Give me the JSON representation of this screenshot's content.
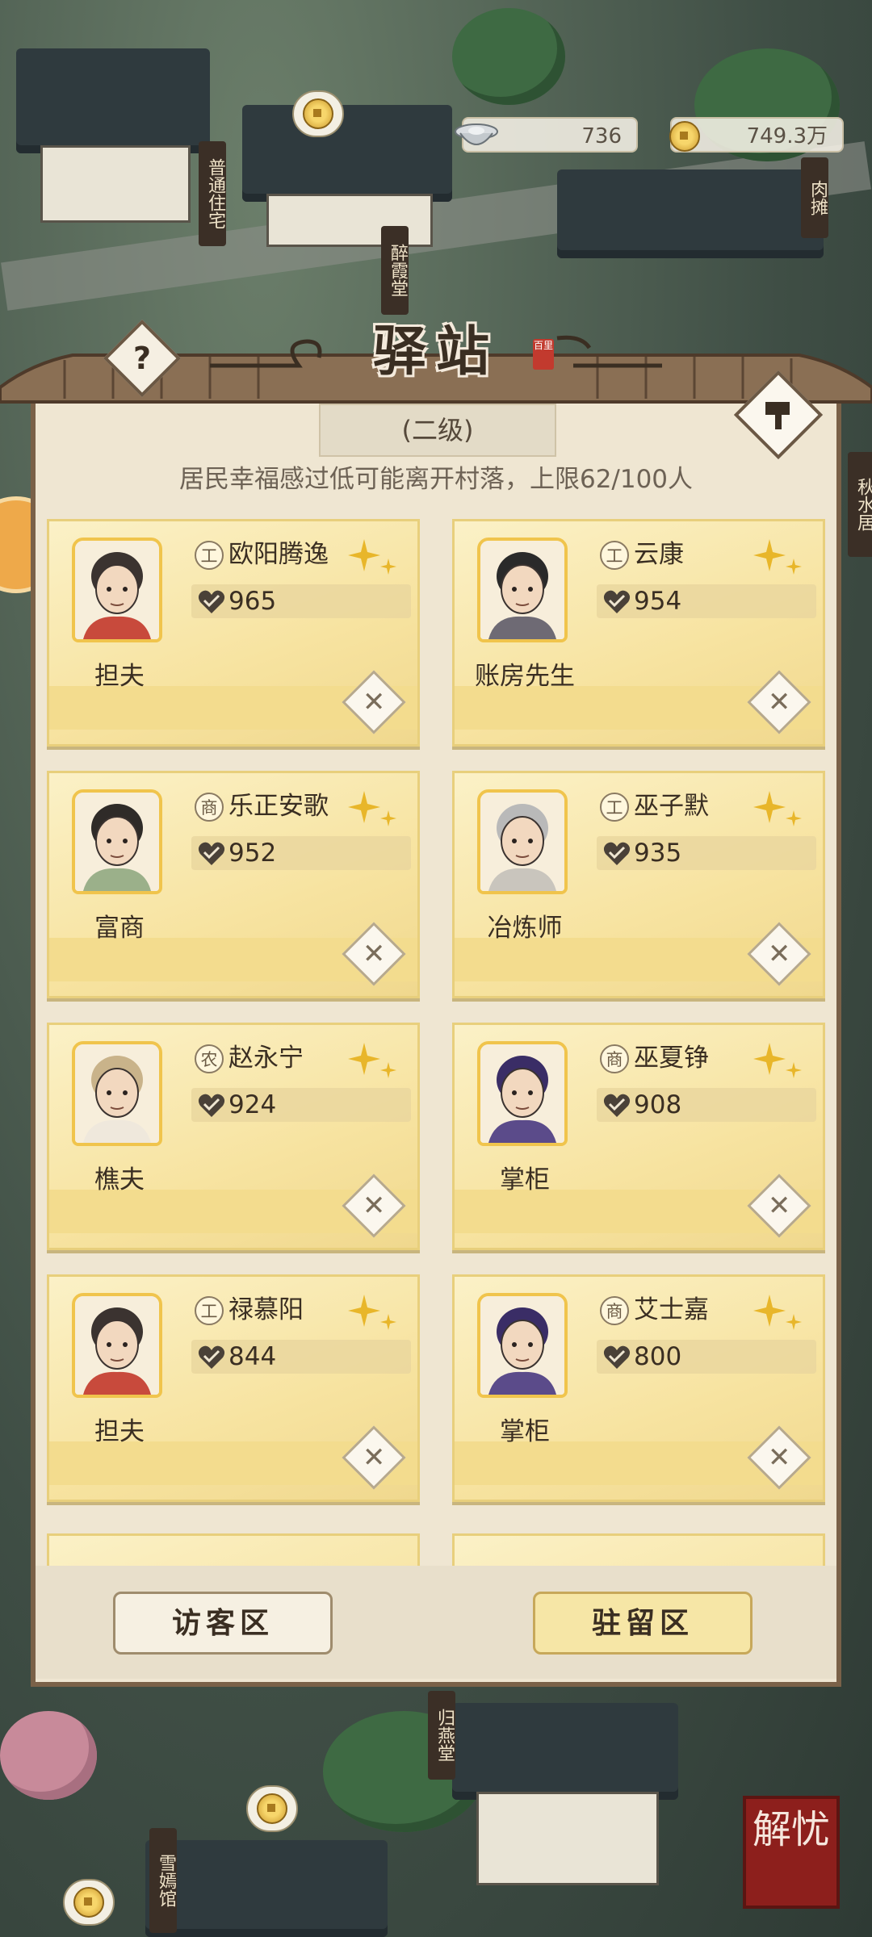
{
  "resources": {
    "silver": "736",
    "coins": "749.3万"
  },
  "panel": {
    "title": "驿站",
    "seal": "百里",
    "level": "(二级)",
    "notice": "居民幸福感过低可能离开村落，上限62/100人"
  },
  "residents": [
    {
      "job": "担夫",
      "category": "工",
      "name": "欧阳腾逸",
      "score": "965"
    },
    {
      "job": "账房先生",
      "category": "工",
      "name": "云康",
      "score": "954"
    },
    {
      "job": "富商",
      "category": "商",
      "name": "乐正安歌",
      "score": "952"
    },
    {
      "job": "冶炼师",
      "category": "工",
      "name": "巫子默",
      "score": "935"
    },
    {
      "job": "樵夫",
      "category": "农",
      "name": "赵永宁",
      "score": "924"
    },
    {
      "job": "掌柜",
      "category": "商",
      "name": "巫夏铮",
      "score": "908"
    },
    {
      "job": "担夫",
      "category": "工",
      "name": "禄慕阳",
      "score": "844"
    },
    {
      "job": "掌柜",
      "category": "商",
      "name": "艾士嘉",
      "score": "800"
    }
  ],
  "tabs": {
    "visitor": "访客区",
    "resident": "驻留区"
  },
  "signs": [
    "普通住宅",
    "醉霞堂",
    "肉摊",
    "秋水居",
    "归燕堂",
    "雪嫣馆"
  ],
  "corner": "解忧",
  "colors": {
    "card": "#f7e6a6",
    "panel": "#efe6d2",
    "frame": "#7a6148",
    "text": "#3a2e22"
  }
}
